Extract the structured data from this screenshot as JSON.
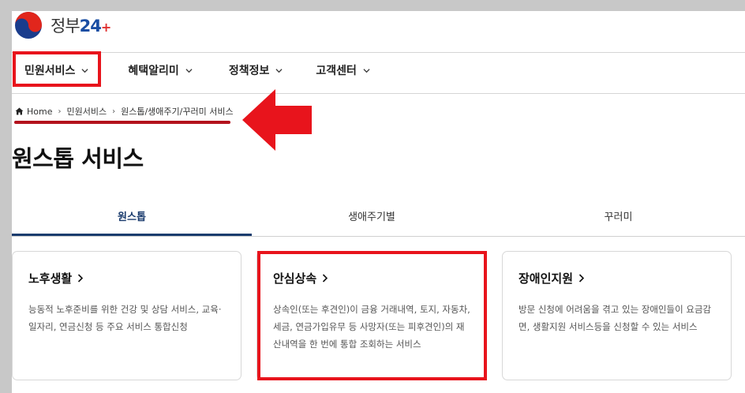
{
  "header": {
    "logo_text": "정부",
    "logo_number": "24",
    "logo_plus": "+",
    "logo_icon": "taegeuk-icon"
  },
  "nav": {
    "items": [
      {
        "label": "민원서비스",
        "icon": "chevron-down-icon",
        "highlighted": true
      },
      {
        "label": "혜택알리미",
        "icon": "chevron-down-icon"
      },
      {
        "label": "정책정보",
        "icon": "chevron-down-icon"
      },
      {
        "label": "고객센터",
        "icon": "chevron-down-icon"
      }
    ]
  },
  "breadcrumb": {
    "home": "Home",
    "home_icon": "home-icon",
    "items": [
      "민원서비스",
      "원스톱/생애주기/꾸러미 서비스"
    ]
  },
  "annotation": {
    "color": "#e8141c",
    "arrow_icon": "left-arrow-icon"
  },
  "page_title": "원스톱 서비스",
  "tabs": [
    {
      "label": "원스톱",
      "active": true
    },
    {
      "label": "생애주기별",
      "active": false
    },
    {
      "label": "꾸러미",
      "active": false
    }
  ],
  "cards": [
    {
      "title": "노후생활",
      "description": "능동적 노후준비를 위한 건강 및 상담 서비스, 교육·일자리, 연금신청 등 주요 서비스 통합신청"
    },
    {
      "title": "안심상속",
      "description": "상속인(또는 후견인)이 금융 거래내역, 토지, 자동차, 세금, 연금가입유무 등 사망자(또는 피후견인)의 재산내역을 한 번에 통합 조회하는 서비스",
      "highlighted": true
    },
    {
      "title": "장애인지원",
      "description": "방문 신청에 어려움을 겪고 있는 장애인들이 요금감면, 생활지원 서비스등을 신청할 수 있는 서비스"
    }
  ],
  "colors": {
    "accent": "#1b3c6e",
    "highlight": "#e8141c",
    "background": "#c8c8c8"
  }
}
